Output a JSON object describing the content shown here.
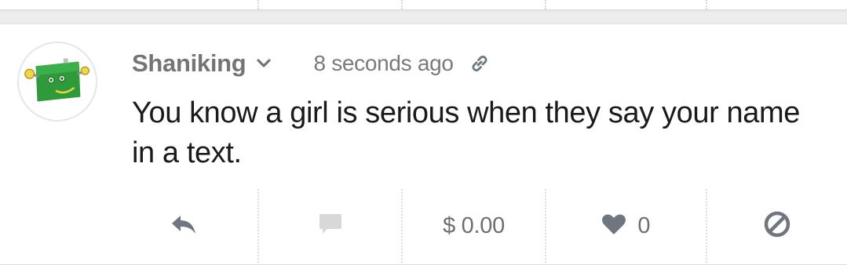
{
  "post": {
    "author": "Shaniking",
    "timestamp": "8 seconds ago",
    "text": "You know a girl is serious when they say your name in a text."
  },
  "actions": {
    "tip_amount": "$ 0.00",
    "like_count": "0"
  },
  "icons": {
    "author_menu": "chevron-down-icon",
    "permalink": "link-icon",
    "reply": "reply-icon",
    "comment": "comment-icon",
    "like": "heart-icon",
    "block": "block-icon"
  },
  "colors": {
    "avatar_green": "#2e9a3a",
    "muted_text": "#757575",
    "icon_gray": "#6f7680",
    "icon_disabled": "#d8d8d8"
  }
}
